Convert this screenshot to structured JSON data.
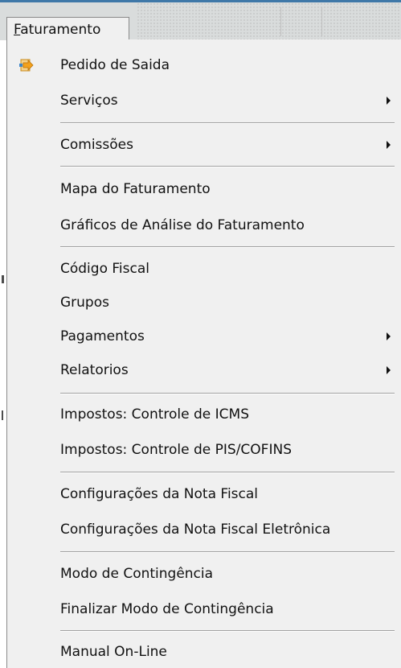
{
  "menubar": {
    "menu": {
      "mnemonic": "F",
      "rest": "aturamento"
    }
  },
  "dropdown": {
    "items": [
      {
        "label": "Pedido de Saida",
        "icon": "arrow-document-icon",
        "submenu": false
      },
      {
        "label": "Serviços",
        "submenu": true
      },
      {
        "label": "Comissões",
        "submenu": true
      },
      {
        "label": "Mapa do Faturamento",
        "submenu": false
      },
      {
        "label": "Gráficos de Análise do Faturamento",
        "submenu": false
      },
      {
        "label": "Código Fiscal",
        "submenu": false
      },
      {
        "label": "Grupos",
        "submenu": false
      },
      {
        "label": "Pagamentos",
        "submenu": true
      },
      {
        "label": "Relatorios",
        "submenu": true
      },
      {
        "label": "Impostos: Controle de ICMS",
        "submenu": false
      },
      {
        "label": "Impostos: Controle de PIS/COFINS",
        "submenu": false
      },
      {
        "label": "Configurações da Nota Fiscal",
        "submenu": false
      },
      {
        "label": "Configurações da Nota Fiscal Eletrônica",
        "submenu": false
      },
      {
        "label": "Modo de Contingência",
        "submenu": false
      },
      {
        "label": "Finalizar Modo de Contingência",
        "submenu": false
      },
      {
        "label": "Manual On-Line",
        "submenu": false
      }
    ]
  },
  "colors": {
    "menu_background": "#f0f0f0",
    "menubar_background": "#d9dcdc",
    "titlebar_accent": "#3f78a8",
    "icon_orange": "#f3a11d",
    "icon_blue": "#3f86c8"
  }
}
